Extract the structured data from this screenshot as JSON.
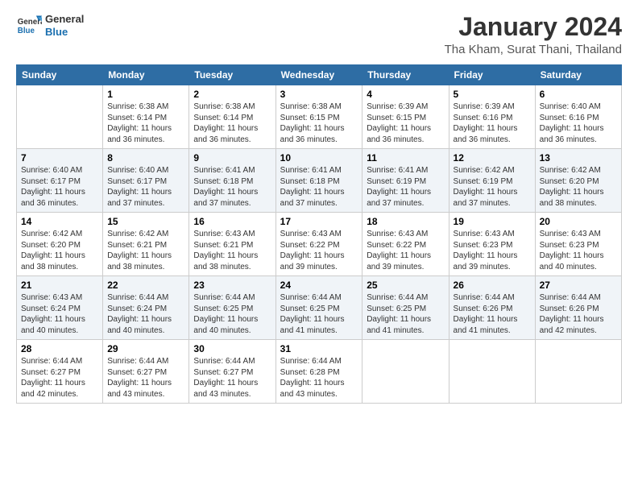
{
  "header": {
    "logo_general": "General",
    "logo_blue": "Blue",
    "title": "January 2024",
    "subtitle": "Tha Kham, Surat Thani, Thailand"
  },
  "days_of_week": [
    "Sunday",
    "Monday",
    "Tuesday",
    "Wednesday",
    "Thursday",
    "Friday",
    "Saturday"
  ],
  "weeks": [
    [
      {
        "day": "",
        "detail": ""
      },
      {
        "day": "1",
        "detail": "Sunrise: 6:38 AM\nSunset: 6:14 PM\nDaylight: 11 hours and 36 minutes."
      },
      {
        "day": "2",
        "detail": "Sunrise: 6:38 AM\nSunset: 6:14 PM\nDaylight: 11 hours and 36 minutes."
      },
      {
        "day": "3",
        "detail": "Sunrise: 6:38 AM\nSunset: 6:15 PM\nDaylight: 11 hours and 36 minutes."
      },
      {
        "day": "4",
        "detail": "Sunrise: 6:39 AM\nSunset: 6:15 PM\nDaylight: 11 hours and 36 minutes."
      },
      {
        "day": "5",
        "detail": "Sunrise: 6:39 AM\nSunset: 6:16 PM\nDaylight: 11 hours and 36 minutes."
      },
      {
        "day": "6",
        "detail": "Sunrise: 6:40 AM\nSunset: 6:16 PM\nDaylight: 11 hours and 36 minutes."
      }
    ],
    [
      {
        "day": "7",
        "detail": "Sunrise: 6:40 AM\nSunset: 6:17 PM\nDaylight: 11 hours and 36 minutes."
      },
      {
        "day": "8",
        "detail": "Sunrise: 6:40 AM\nSunset: 6:17 PM\nDaylight: 11 hours and 37 minutes."
      },
      {
        "day": "9",
        "detail": "Sunrise: 6:41 AM\nSunset: 6:18 PM\nDaylight: 11 hours and 37 minutes."
      },
      {
        "day": "10",
        "detail": "Sunrise: 6:41 AM\nSunset: 6:18 PM\nDaylight: 11 hours and 37 minutes."
      },
      {
        "day": "11",
        "detail": "Sunrise: 6:41 AM\nSunset: 6:19 PM\nDaylight: 11 hours and 37 minutes."
      },
      {
        "day": "12",
        "detail": "Sunrise: 6:42 AM\nSunset: 6:19 PM\nDaylight: 11 hours and 37 minutes."
      },
      {
        "day": "13",
        "detail": "Sunrise: 6:42 AM\nSunset: 6:20 PM\nDaylight: 11 hours and 38 minutes."
      }
    ],
    [
      {
        "day": "14",
        "detail": "Sunrise: 6:42 AM\nSunset: 6:20 PM\nDaylight: 11 hours and 38 minutes."
      },
      {
        "day": "15",
        "detail": "Sunrise: 6:42 AM\nSunset: 6:21 PM\nDaylight: 11 hours and 38 minutes."
      },
      {
        "day": "16",
        "detail": "Sunrise: 6:43 AM\nSunset: 6:21 PM\nDaylight: 11 hours and 38 minutes."
      },
      {
        "day": "17",
        "detail": "Sunrise: 6:43 AM\nSunset: 6:22 PM\nDaylight: 11 hours and 39 minutes."
      },
      {
        "day": "18",
        "detail": "Sunrise: 6:43 AM\nSunset: 6:22 PM\nDaylight: 11 hours and 39 minutes."
      },
      {
        "day": "19",
        "detail": "Sunrise: 6:43 AM\nSunset: 6:23 PM\nDaylight: 11 hours and 39 minutes."
      },
      {
        "day": "20",
        "detail": "Sunrise: 6:43 AM\nSunset: 6:23 PM\nDaylight: 11 hours and 40 minutes."
      }
    ],
    [
      {
        "day": "21",
        "detail": "Sunrise: 6:43 AM\nSunset: 6:24 PM\nDaylight: 11 hours and 40 minutes."
      },
      {
        "day": "22",
        "detail": "Sunrise: 6:44 AM\nSunset: 6:24 PM\nDaylight: 11 hours and 40 minutes."
      },
      {
        "day": "23",
        "detail": "Sunrise: 6:44 AM\nSunset: 6:25 PM\nDaylight: 11 hours and 40 minutes."
      },
      {
        "day": "24",
        "detail": "Sunrise: 6:44 AM\nSunset: 6:25 PM\nDaylight: 11 hours and 41 minutes."
      },
      {
        "day": "25",
        "detail": "Sunrise: 6:44 AM\nSunset: 6:25 PM\nDaylight: 11 hours and 41 minutes."
      },
      {
        "day": "26",
        "detail": "Sunrise: 6:44 AM\nSunset: 6:26 PM\nDaylight: 11 hours and 41 minutes."
      },
      {
        "day": "27",
        "detail": "Sunrise: 6:44 AM\nSunset: 6:26 PM\nDaylight: 11 hours and 42 minutes."
      }
    ],
    [
      {
        "day": "28",
        "detail": "Sunrise: 6:44 AM\nSunset: 6:27 PM\nDaylight: 11 hours and 42 minutes."
      },
      {
        "day": "29",
        "detail": "Sunrise: 6:44 AM\nSunset: 6:27 PM\nDaylight: 11 hours and 43 minutes."
      },
      {
        "day": "30",
        "detail": "Sunrise: 6:44 AM\nSunset: 6:27 PM\nDaylight: 11 hours and 43 minutes."
      },
      {
        "day": "31",
        "detail": "Sunrise: 6:44 AM\nSunset: 6:28 PM\nDaylight: 11 hours and 43 minutes."
      },
      {
        "day": "",
        "detail": ""
      },
      {
        "day": "",
        "detail": ""
      },
      {
        "day": "",
        "detail": ""
      }
    ]
  ]
}
